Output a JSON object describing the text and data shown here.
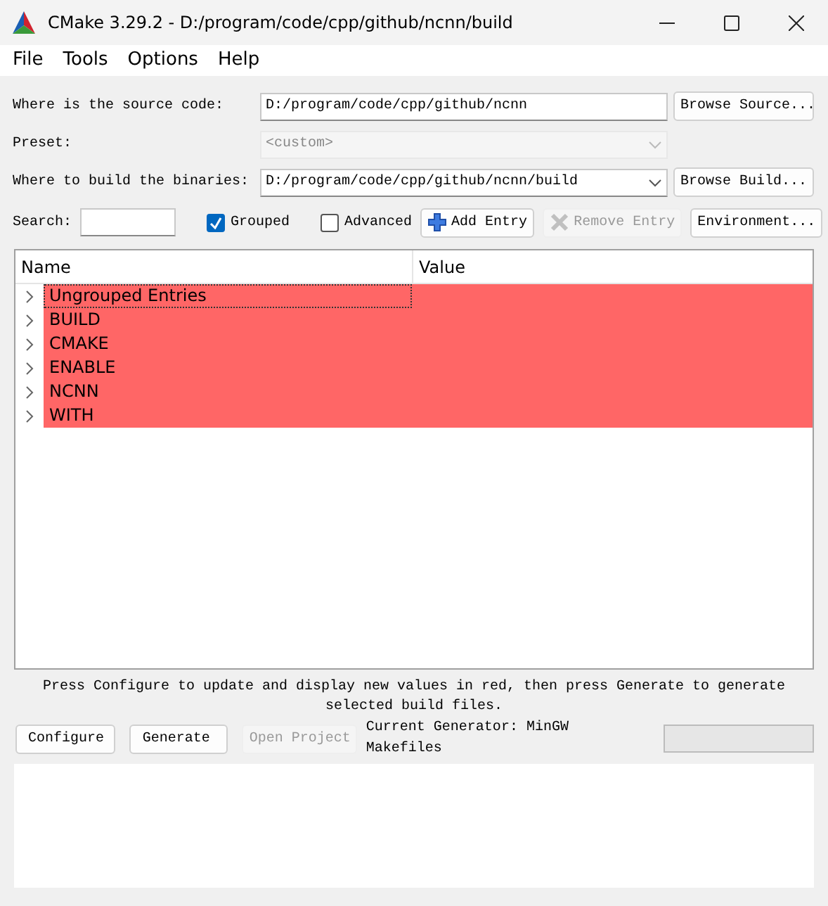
{
  "window": {
    "title": "CMake 3.29.2 - D:/program/code/cpp/github/ncnn/build"
  },
  "menu": [
    "File",
    "Tools",
    "Options",
    "Help"
  ],
  "source": {
    "label": "Where is the source code:",
    "value": "D:/program/code/cpp/github/ncnn",
    "button": "Browse Source..."
  },
  "preset": {
    "label": "Preset:",
    "value": "<custom>",
    "disabled": true
  },
  "binaries": {
    "label": "Where to build the binaries:",
    "value": "D:/program/code/cpp/github/ncnn/build",
    "button": "Browse Build..."
  },
  "toolbar": {
    "search_label": "Search:",
    "checkboxes": [
      {
        "label": "Grouped",
        "checked": true
      },
      {
        "label": "Advanced",
        "checked": false
      }
    ],
    "buttons": [
      {
        "label": "Add Entry",
        "kind": "add",
        "disabled": false
      },
      {
        "label": "Remove Entry",
        "kind": "remove",
        "disabled": true
      },
      {
        "label": "Environment...",
        "kind": "plain",
        "disabled": false
      }
    ]
  },
  "table": {
    "columns": [
      "Name",
      "Value"
    ],
    "rows": [
      {
        "name": "Ungrouped Entries",
        "expanded": false,
        "new": true,
        "selected": true
      },
      {
        "name": "BUILD",
        "expanded": false,
        "new": true,
        "selected": false
      },
      {
        "name": "CMAKE",
        "expanded": false,
        "new": true,
        "selected": false
      },
      {
        "name": "ENABLE",
        "expanded": false,
        "new": true,
        "selected": false
      },
      {
        "name": "NCNN",
        "expanded": false,
        "new": true,
        "selected": false
      },
      {
        "name": "WITH",
        "expanded": false,
        "new": true,
        "selected": false
      }
    ]
  },
  "message": "Press Configure to update and display new values in red, then press Generate to generate selected build files.",
  "actions": [
    {
      "label": "Configure",
      "disabled": false
    },
    {
      "label": "Generate",
      "disabled": false
    },
    {
      "label": "Open Project",
      "disabled": true
    }
  ],
  "generator": "Current Generator: MinGW Makefiles",
  "progress": {
    "level": 0
  }
}
